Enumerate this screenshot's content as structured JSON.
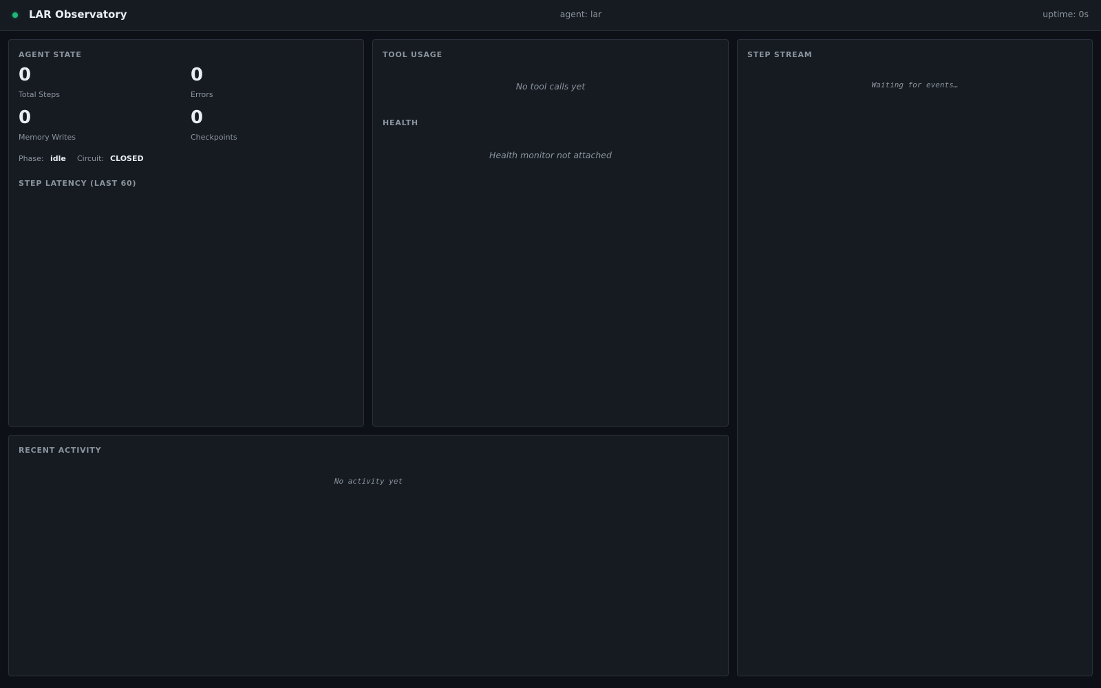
{
  "header": {
    "title": "LAR Observatory",
    "agent": "agent: lar",
    "uptime": "uptime: 0s",
    "status_color": "#1fb87a"
  },
  "agent_state": {
    "title": "AGENT STATE",
    "metrics": [
      {
        "value": "0",
        "label": "Total Steps"
      },
      {
        "value": "0",
        "label": "Errors"
      },
      {
        "value": "0",
        "label": "Memory Writes"
      },
      {
        "value": "0",
        "label": "Checkpoints"
      }
    ],
    "phase_label": "Phase:",
    "phase_value": "idle",
    "circuit_label": "Circuit:",
    "circuit_value": "CLOSED",
    "latency_title": "STEP LATENCY (LAST 60)"
  },
  "tool_usage": {
    "title": "TOOL USAGE",
    "empty": "No tool calls yet",
    "health_title": "HEALTH",
    "health_empty": "Health monitor not attached"
  },
  "step_stream": {
    "title": "STEP STREAM",
    "empty": "Waiting for events…"
  },
  "recent_activity": {
    "title": "RECENT ACTIVITY",
    "empty": "No activity yet"
  },
  "colors": {
    "background": "#0d1117",
    "panel": "#161b22",
    "border": "#2a313c",
    "muted_text": "#8b949e",
    "bright_text": "#e6edf3",
    "accent_green": "#1fb87a"
  }
}
